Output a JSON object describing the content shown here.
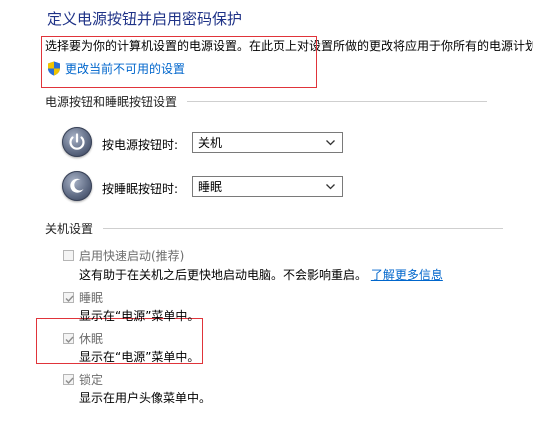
{
  "page": {
    "title": "定义电源按钮并启用密码保护",
    "intro": "选择要为你的计算机设置的电源设置。在此页上对设置所做的更改将应用于你所有的电源计划。",
    "change_link": "更改当前不可用的设置"
  },
  "buttons_section": {
    "heading": "电源按钮和睡眠按钮设置",
    "power_label": "按电源按钮时:",
    "power_value": "关机",
    "sleep_label": "按睡眠按钮时:",
    "sleep_value": "睡眠"
  },
  "shutdown_section": {
    "heading": "关机设置",
    "items": [
      {
        "label": "启用快速启动(推荐)",
        "checked": false,
        "desc": "这有助于在关机之后更快地启动电脑。不会影响重启。",
        "link": "了解更多信息"
      },
      {
        "label": "睡眠",
        "checked": true,
        "desc": "显示在“电源”菜单中。"
      },
      {
        "label": "休眠",
        "checked": true,
        "desc": "显示在“电源”菜单中。"
      },
      {
        "label": "锁定",
        "checked": true,
        "desc": "显示在用户头像菜单中。"
      }
    ]
  },
  "colors": {
    "title": "#1e3287",
    "link": "#0066cc",
    "highlight_box": "#e0343a",
    "disabled_text": "#6d6d6d"
  },
  "icons": {
    "uac": "shield-icon",
    "power": "power-button-icon",
    "sleep": "sleep-button-icon",
    "dropdown": "chevron-down-icon",
    "check": "checkmark-icon"
  }
}
